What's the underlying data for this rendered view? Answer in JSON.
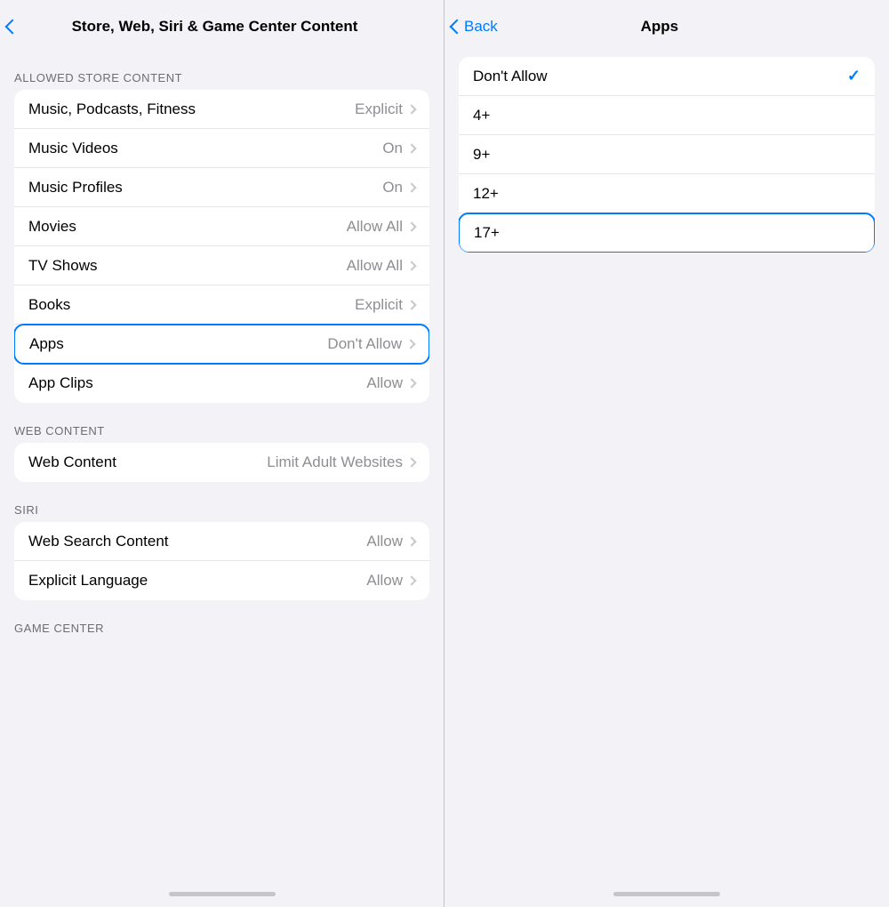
{
  "left": {
    "back_label": "",
    "title": "Store, Web, Siri & Game Center Content",
    "sections": [
      {
        "label": "ALLOWED STORE CONTENT",
        "rows": [
          {
            "id": "music-podcasts",
            "label": "Music, Podcasts, Fitness",
            "value": "Explicit",
            "highlighted": false
          },
          {
            "id": "music-videos",
            "label": "Music Videos",
            "value": "On",
            "highlighted": false
          },
          {
            "id": "music-profiles",
            "label": "Music Profiles",
            "value": "On",
            "highlighted": false
          },
          {
            "id": "movies",
            "label": "Movies",
            "value": "Allow All",
            "highlighted": false
          },
          {
            "id": "tv-shows",
            "label": "TV Shows",
            "value": "Allow All",
            "highlighted": false
          },
          {
            "id": "books",
            "label": "Books",
            "value": "Explicit",
            "highlighted": false
          },
          {
            "id": "apps",
            "label": "Apps",
            "value": "Don't Allow",
            "highlighted": true
          },
          {
            "id": "app-clips",
            "label": "App Clips",
            "value": "Allow",
            "highlighted": false
          }
        ]
      },
      {
        "label": "WEB CONTENT",
        "rows": [
          {
            "id": "web-content",
            "label": "Web Content",
            "value": "Limit Adult Websites",
            "highlighted": false
          }
        ]
      },
      {
        "label": "SIRI",
        "rows": [
          {
            "id": "web-search",
            "label": "Web Search Content",
            "value": "Allow",
            "highlighted": false
          },
          {
            "id": "explicit-language",
            "label": "Explicit Language",
            "value": "Allow",
            "highlighted": false
          }
        ]
      },
      {
        "label": "GAME CENTER",
        "rows": []
      }
    ]
  },
  "right": {
    "back_label": "Back",
    "title": "Apps",
    "options": [
      {
        "id": "dont-allow",
        "label": "Don't Allow",
        "checked": true,
        "highlighted": false
      },
      {
        "id": "4plus",
        "label": "4+",
        "checked": false,
        "highlighted": false
      },
      {
        "id": "9plus",
        "label": "9+",
        "checked": false,
        "highlighted": false
      },
      {
        "id": "12plus",
        "label": "12+",
        "checked": false,
        "highlighted": false
      },
      {
        "id": "17plus",
        "label": "17+",
        "checked": false,
        "highlighted": true
      }
    ]
  }
}
